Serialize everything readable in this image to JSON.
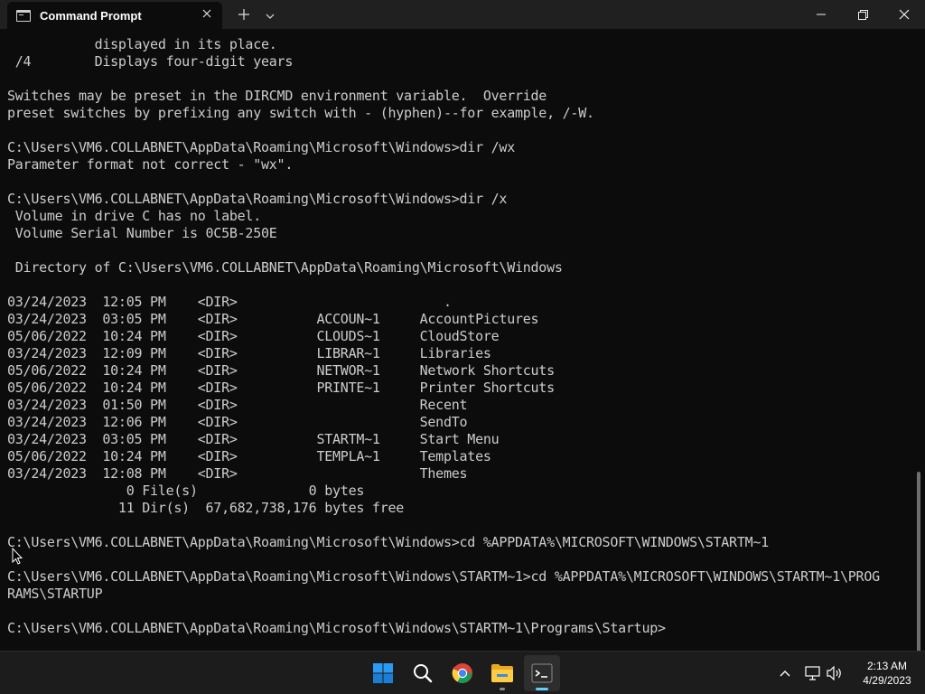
{
  "window": {
    "tab_title": "Command Prompt",
    "icons": {
      "tab": "cmd-icon",
      "close_tab": "close-icon",
      "new_tab": "plus-icon",
      "dropdown": "chevron-down-icon",
      "minimize": "minimize-icon",
      "maximize": "restore-icon",
      "close": "close-icon"
    }
  },
  "terminal": {
    "colors": {
      "background": "#0c0c0c",
      "text": "#cccccc"
    },
    "output": "           displayed in its place.\n /4        Displays four-digit years\n\nSwitches may be preset in the DIRCMD environment variable.  Override\npreset switches by prefixing any switch with - (hyphen)--for example, /-W.\n\nC:\\Users\\VM6.COLLABNET\\AppData\\Roaming\\Microsoft\\Windows>dir /wx\nParameter format not correct - \"wx\".\n\nC:\\Users\\VM6.COLLABNET\\AppData\\Roaming\\Microsoft\\Windows>dir /x\n Volume in drive C has no label.\n Volume Serial Number is 0C5B-250E\n\n Directory of C:\\Users\\VM6.COLLABNET\\AppData\\Roaming\\Microsoft\\Windows\n\n03/24/2023  12:05 PM    <DIR>                          .\n03/24/2023  03:05 PM    <DIR>          ACCOUN~1     AccountPictures\n05/06/2022  10:24 PM    <DIR>          CLOUDS~1     CloudStore\n03/24/2023  12:09 PM    <DIR>          LIBRAR~1     Libraries\n05/06/2022  10:24 PM    <DIR>          NETWOR~1     Network Shortcuts\n05/06/2022  10:24 PM    <DIR>          PRINTE~1     Printer Shortcuts\n03/24/2023  01:50 PM    <DIR>                       Recent\n03/24/2023  12:06 PM    <DIR>                       SendTo\n03/24/2023  03:05 PM    <DIR>          STARTM~1     Start Menu\n05/06/2022  10:24 PM    <DIR>          TEMPLA~1     Templates\n03/24/2023  12:08 PM    <DIR>                       Themes\n               0 File(s)              0 bytes\n              11 Dir(s)  67,682,738,176 bytes free\n\nC:\\Users\\VM6.COLLABNET\\AppData\\Roaming\\Microsoft\\Windows>cd %APPDATA%\\MICROSOFT\\WINDOWS\\STARTM~1\n\nC:\\Users\\VM6.COLLABNET\\AppData\\Roaming\\Microsoft\\Windows\\STARTM~1>cd %APPDATA%\\MICROSOFT\\WINDOWS\\STARTM~1\\PROG\nRAMS\\STARTUP\n\nC:\\Users\\VM6.COLLABNET\\AppData\\Roaming\\Microsoft\\Windows\\STARTM~1\\Programs\\Startup>"
  },
  "taskbar": {
    "apps": [
      {
        "name": "start",
        "icon": "windows-logo-icon"
      },
      {
        "name": "search",
        "icon": "search-icon"
      },
      {
        "name": "chrome",
        "icon": "chrome-icon"
      },
      {
        "name": "file-explorer",
        "icon": "folder-icon"
      },
      {
        "name": "terminal",
        "icon": "terminal-icon",
        "active": true
      }
    ],
    "tray": {
      "icons": [
        "chevron-up-icon",
        "network-icon",
        "volume-icon"
      ]
    },
    "clock": {
      "time": "2:13 AM",
      "date": "4/29/2023"
    },
    "accent": "#60cdff"
  }
}
